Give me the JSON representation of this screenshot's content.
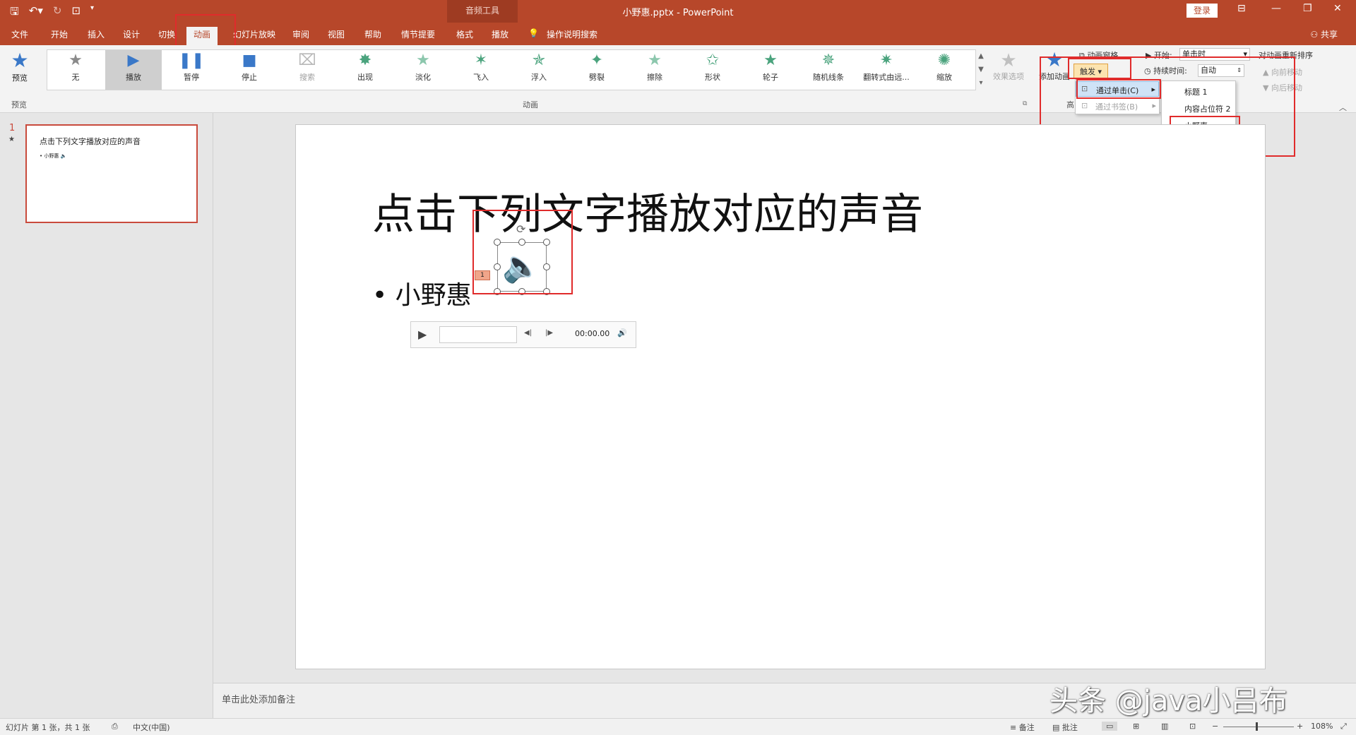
{
  "title_bar": {
    "document_title": "小野惠.pptx  -  PowerPoint",
    "contextual_group": "音频工具",
    "login_label": "登录"
  },
  "colors": {
    "accent": "#b7472a",
    "highlight_red": "#e02b2b",
    "gallery_icon": "#4aa37d",
    "play_icon": "#3a78c8"
  },
  "tabs": [
    "文件",
    "开始",
    "插入",
    "设计",
    "切换",
    "动画",
    "幻灯片放映",
    "审阅",
    "视图",
    "帮助",
    "情节提要",
    "格式",
    "播放"
  ],
  "active_tab": "动画",
  "tell_me": "操作说明搜索",
  "share_label": "共享",
  "ribbon": {
    "preview_label": "预览",
    "preview_group": "预览",
    "animation_group": "动画",
    "advanced_group_partial": "高",
    "gallery": [
      {
        "label": "无",
        "icon": "star-gray-icon"
      },
      {
        "label": "播放",
        "icon": "play-icon"
      },
      {
        "label": "暂停",
        "icon": "pause-icon"
      },
      {
        "label": "停止",
        "icon": "stop-icon"
      },
      {
        "label": "搜索",
        "icon": "camera-icon"
      },
      {
        "label": "出现",
        "icon": "star-burst-icon"
      },
      {
        "label": "淡化",
        "icon": "star-fade-icon"
      },
      {
        "label": "飞入",
        "icon": "star-fly-icon"
      },
      {
        "label": "浮入",
        "icon": "star-float-icon"
      },
      {
        "label": "劈裂",
        "icon": "star-split-icon"
      },
      {
        "label": "擦除",
        "icon": "star-wipe-icon"
      },
      {
        "label": "形状",
        "icon": "star-shape-icon"
      },
      {
        "label": "轮子",
        "icon": "star-wheel-icon"
      },
      {
        "label": "随机线条",
        "icon": "star-random-icon"
      },
      {
        "label": "翻转式由远...",
        "icon": "star-flip-icon"
      },
      {
        "label": "缩放",
        "icon": "star-zoom-icon"
      }
    ],
    "effect_options": "效果选项",
    "add_animation": "添加动画",
    "animation_pane": "动画窗格",
    "trigger": "触发",
    "start_label": "开始:",
    "start_value": "单击时",
    "duration_label": "持续时间:",
    "duration_value": "自动",
    "reorder_label": "对动画重新排序",
    "move_earlier": "向前移动",
    "move_later": "向后移动"
  },
  "trigger_menu": {
    "by_click": "通过单击(C)",
    "by_bookmark": "通过书签(B)"
  },
  "submenu": {
    "items": [
      "标题 1",
      "内容占位符 2",
      "小野惠"
    ]
  },
  "thumbnail": {
    "number": "1",
    "star": "★",
    "title": "点击下列文字播放对应的声音",
    "bullet": "• 小野惠"
  },
  "slide": {
    "title": "点击下列文字播放对应的声音",
    "bullet": "• 小野惠",
    "anim_tag": "1"
  },
  "player": {
    "time": "00:00.00"
  },
  "notes_placeholder": "单击此处添加备注",
  "status": {
    "slide_info": "幻灯片 第 1 张，共 1 张",
    "language": "中文(中国)",
    "notes": "备注",
    "comments": "批注",
    "zoom": "108%"
  },
  "watermark": "头条 @java小吕布"
}
